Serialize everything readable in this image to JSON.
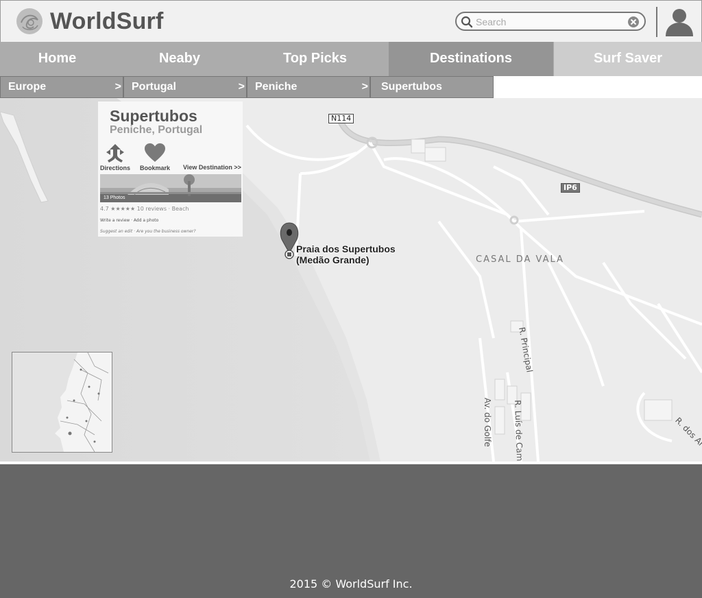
{
  "app": {
    "brand": "WorldSurf"
  },
  "search": {
    "placeholder": "Search",
    "value": ""
  },
  "nav": {
    "items": [
      {
        "label": "Home"
      },
      {
        "label": "Neaby"
      },
      {
        "label": "Top Picks"
      },
      {
        "label": "Destinations",
        "active": true
      },
      {
        "label": "Surf Saver"
      }
    ]
  },
  "breadcrumb": {
    "separator": ">",
    "items": [
      {
        "label": "Europe"
      },
      {
        "label": "Portugal"
      },
      {
        "label": "Peniche"
      },
      {
        "label": "Supertubos"
      }
    ]
  },
  "map": {
    "roads": {
      "n114": "N114",
      "ip6": "IP6"
    },
    "area": "CASAL DA VALA",
    "streets": {
      "principal": "R. Principal",
      "golfe": "Av. do Golfe",
      "camoes": "R. Luís de Camõe",
      "dos": "R. dos Ar"
    },
    "pin": {
      "line1": "Praia dos Supertubos",
      "line2": "(Medão Grande)"
    }
  },
  "place_card": {
    "title": "Supertubos",
    "subtitle": "Peniche, Portugal",
    "actions": {
      "directions": "Directions",
      "bookmark": "Bookmark",
      "view": "View Destination >>"
    },
    "photos": "13 Photos",
    "rating": "4.7 ★★★★★  10 reviews · Beach",
    "links": "Write a review · Add a photo",
    "suggest": "Suggest an edit · Are you the business owner?"
  },
  "footer": {
    "copyright": "2015 © WorldSurf Inc."
  },
  "colors": {
    "nav_bg": "#acacac",
    "nav_active": "#959595",
    "footer_bg": "#666666"
  }
}
